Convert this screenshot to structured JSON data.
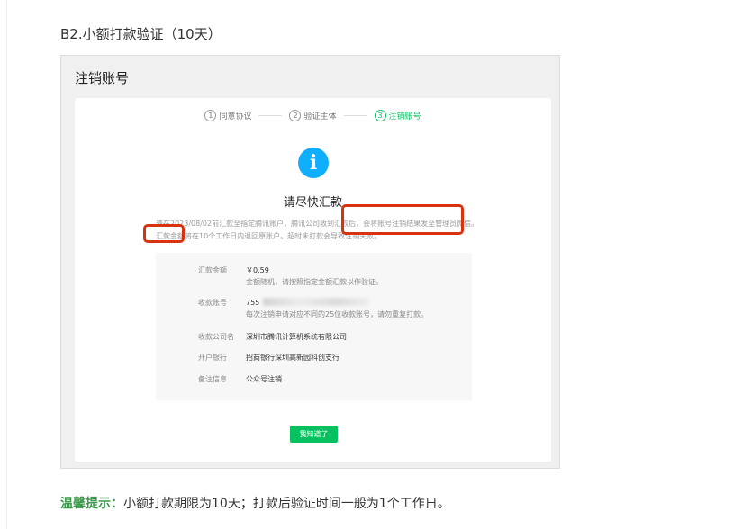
{
  "section_heading": "B2.小额打款验证（10天）",
  "window_title": "注销账号",
  "steps": [
    {
      "num": "1",
      "label": "同意协议"
    },
    {
      "num": "2",
      "label": "验证主体"
    },
    {
      "num": "3",
      "label": "注销账号"
    }
  ],
  "notice": {
    "icon": "i",
    "title": "请尽快汇款",
    "text": "请在2023/08/02前汇款至指定腾讯账户，腾讯公司收到汇款后，会将账号注销结果发至管理员微信。汇款金额将在10个工作日内退回原账户。超时未打款会导致注销失败。"
  },
  "details": [
    {
      "label": "汇款金额",
      "value": "￥0.59",
      "sub": "金额随机，请按照指定金额汇款以作验证。"
    },
    {
      "label": "收款账号",
      "value": "755",
      "sub": "每次注销申请对应不同的25位收款账号，请勿重复打款。"
    },
    {
      "label": "收款公司名",
      "value": "深圳市腾讯计算机系统有限公司"
    },
    {
      "label": "开户银行",
      "value": "招商银行深圳高新园科创支行"
    },
    {
      "label": "备注信息",
      "value": "公众号注销"
    }
  ],
  "ok_button": "我知道了",
  "tip": {
    "label": "温馨提示：",
    "text": "小额打款期限为10天；打款后验证时间一般为1个工作日。"
  },
  "colors": {
    "accent_green": "#07c160",
    "info_blue": "#10aeff",
    "highlight_red": "#d9320e",
    "tip_green": "#3d9a4c"
  }
}
